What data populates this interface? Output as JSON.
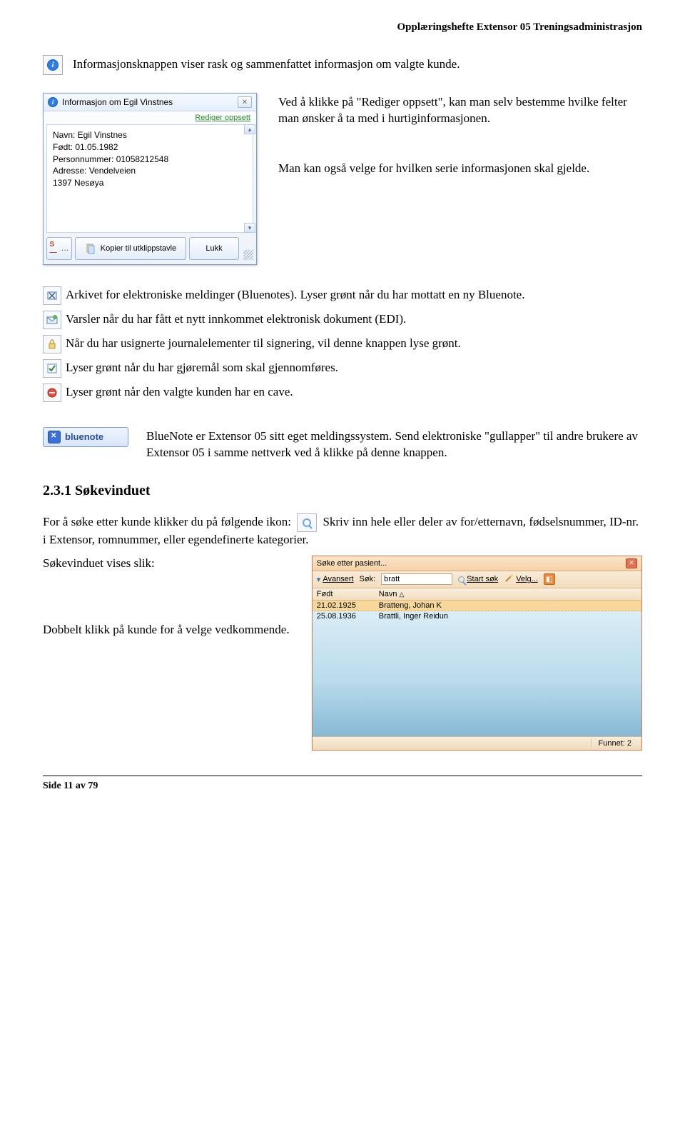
{
  "header": "Opplæringshefte Extensor 05 Treningsadministrasjon",
  "intro": "Informasjonsknappen viser rask og sammenfattet informasjon om valgte kunde.",
  "dialog": {
    "title": "Informasjon om Egil Vinstnes",
    "edit_link": "Rediger oppsett",
    "lines": {
      "name": "Navn: Egil Vinstnes",
      "born": "Født: 01.05.1982",
      "pnr": "Personnummer: 01058212548",
      "addr": "Adresse: Vendelveien",
      "city": "1397 Nesøya"
    },
    "footer": {
      "sbtn": "S—",
      "copy": "Kopier til utklippstavle",
      "close": "Lukk"
    }
  },
  "side": {
    "p1": "Ved å klikke på \"Rediger oppsett\", kan man selv bestemme hvilke felter man ønsker å ta med i hurtiginformasjonen.",
    "p2": "Man kan også velge for hvilken serie informasjonen skal gjelde."
  },
  "iconlist": {
    "archive": " Arkivet for elektroniske meldinger (Bluenotes). Lyser grønt når du har mottatt en ny Bluenote.",
    "edi": "Varsler når du har fått et nytt innkommet elektronisk dokument (EDI).",
    "sign": "Når du har usignerte journalelementer til signering, vil denne knappen lyse grønt.",
    "task": "Lyser grønt når du har gjøremål som skal gjennomføres.",
    "cave": "Lyser grønt når den valgte kunden har en cave."
  },
  "bluenote": {
    "label": "bluenote",
    "desc": "BlueNote er Extensor 05 sitt eget meldingssystem. Send elektroniske \"gullapper\" til andre brukere av Extensor 05 i samme nettverk ved å klikke på denne knappen."
  },
  "section_heading": "2.3.1  Søkevinduet",
  "search": {
    "p1a": "For å søke etter kunde klikker du på følgende ikon: ",
    "p1b": " Skriv inn hele eller deler av for/etternavn, fødselsnummer, ID-nr. i Extensor, romnummer, eller egendefinerte kategorier.",
    "p2": "Søkevinduet vises slik:",
    "p3": "Dobbelt klikk på kunde for å velge vedkommende."
  },
  "search_window": {
    "title": "Søke etter pasient...",
    "toolbar": {
      "adv": "Avansert",
      "label": "Søk:",
      "value": "bratt",
      "start": "Start søk",
      "choose": "Velg..."
    },
    "cols": {
      "c1": "Født",
      "c2": "Navn"
    },
    "rows": [
      {
        "d": "21.02.1925",
        "n": "Bratteng, Johan K"
      },
      {
        "d": "25.08.1936",
        "n": "Brattli, Inger Reidun"
      }
    ],
    "found": "Funnet: 2"
  },
  "footer": "Side 11 av 79"
}
